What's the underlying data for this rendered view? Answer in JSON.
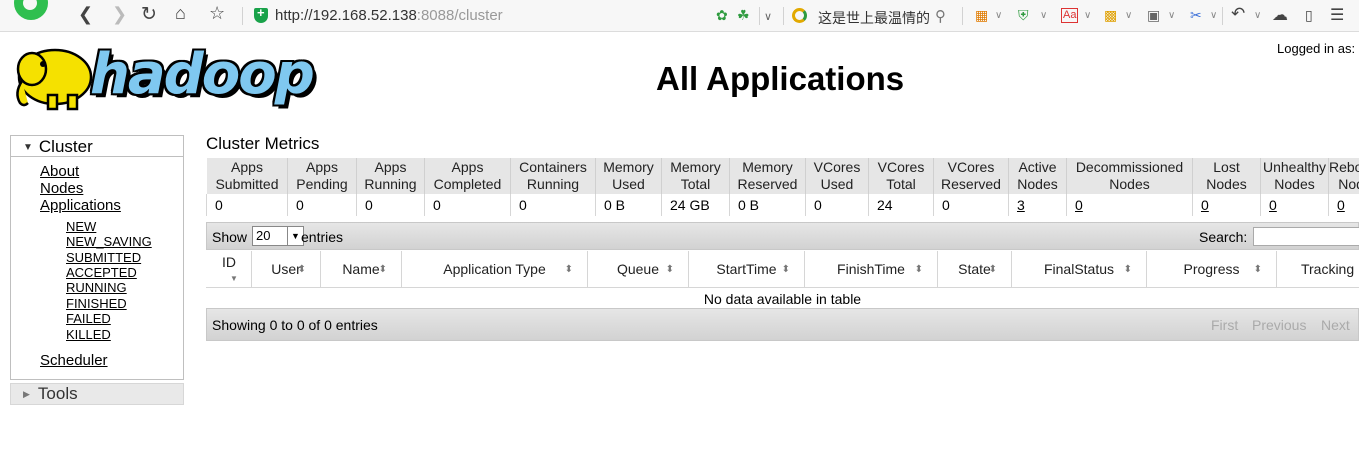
{
  "browser": {
    "url_host": "http://192.168.52.138",
    "url_rest": ":8088/cluster",
    "search_text": "这是世上最温情的"
  },
  "header": {
    "logo_text": "hadoop",
    "title": "All Applications",
    "logged_in": "Logged in as:"
  },
  "sidebar": {
    "cluster_label": "Cluster",
    "links": [
      {
        "label": "About"
      },
      {
        "label": "Nodes"
      },
      {
        "label": "Applications"
      }
    ],
    "states": [
      "NEW",
      "NEW_SAVING",
      "SUBMITTED",
      "ACCEPTED",
      "RUNNING",
      "FINISHED",
      "FAILED",
      "KILLED"
    ],
    "scheduler_label": "Scheduler",
    "tools_label": "Tools"
  },
  "metrics": {
    "title": "Cluster Metrics",
    "headers": [
      [
        "Apps",
        "Submitted"
      ],
      [
        "Apps",
        "Pending"
      ],
      [
        "Apps",
        "Running"
      ],
      [
        "Apps",
        "Completed"
      ],
      [
        "Containers",
        "Running"
      ],
      [
        "Memory",
        "Used"
      ],
      [
        "Memory",
        "Total"
      ],
      [
        "Memory",
        "Reserved"
      ],
      [
        "VCores",
        "Used"
      ],
      [
        "VCores",
        "Total"
      ],
      [
        "VCores",
        "Reserved"
      ],
      [
        "Active",
        "Nodes"
      ],
      [
        "Decommissioned",
        "Nodes"
      ],
      [
        "Lost",
        "Nodes"
      ],
      [
        "Unhealthy",
        "Nodes"
      ],
      [
        "Rebooted",
        "Nodes"
      ]
    ],
    "values": [
      "0",
      "0",
      "0",
      "0",
      "0",
      "0 B",
      "24 GB",
      "0 B",
      "0",
      "24",
      "0",
      "3",
      "0",
      "0",
      "0",
      "0"
    ],
    "linked": [
      false,
      false,
      false,
      false,
      false,
      false,
      false,
      false,
      false,
      false,
      false,
      true,
      true,
      true,
      true,
      true
    ]
  },
  "apps_table": {
    "show_label": "Show",
    "length_value": "20",
    "entries_label": "entries",
    "search_label": "Search:",
    "columns": [
      "ID",
      "User",
      "Name",
      "Application Type",
      "Queue",
      "StartTime",
      "FinishTime",
      "State",
      "FinalStatus",
      "Progress",
      "Tracking UI"
    ],
    "empty_message": "No data available in table",
    "info": "Showing 0 to 0 of 0 entries",
    "pager": {
      "first": "First",
      "previous": "Previous",
      "next": "Next"
    }
  }
}
